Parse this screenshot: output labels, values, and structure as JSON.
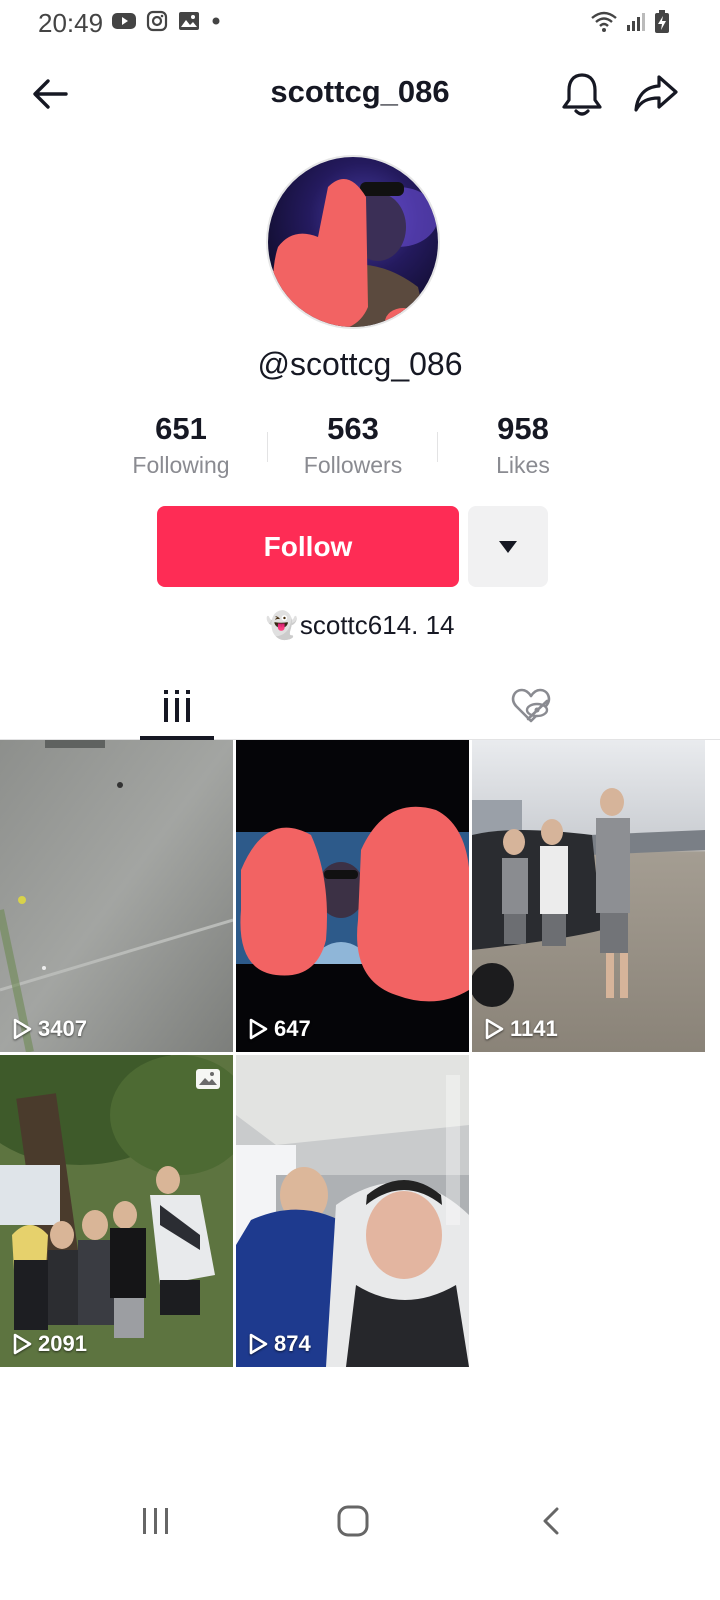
{
  "status_bar": {
    "time": "20:49",
    "left_icons": [
      "youtube-icon",
      "instagram-icon",
      "gallery-icon",
      "dot-icon"
    ],
    "right_icons": [
      "wifi-icon",
      "signal-icon",
      "battery-charging-icon"
    ]
  },
  "header": {
    "title": "scottcg_086",
    "back_icon": "back-arrow-icon",
    "bell_icon": "bell-icon",
    "share_icon": "share-icon"
  },
  "profile": {
    "handle": "@scottcg_086",
    "stats": [
      {
        "value": "651",
        "label": "Following"
      },
      {
        "value": "563",
        "label": "Followers"
      },
      {
        "value": "958",
        "label": "Likes"
      }
    ],
    "follow_label": "Follow",
    "bio_emoji": "👻",
    "bio": "scottc614.  14"
  },
  "tabs": [
    {
      "name": "videos",
      "icon": "grid-icon",
      "active": true
    },
    {
      "name": "liked",
      "icon": "liked-hidden-icon",
      "active": false
    }
  ],
  "videos": [
    {
      "views": "3407"
    },
    {
      "views": "647"
    },
    {
      "views": "1141"
    },
    {
      "views": "2091",
      "is_photo": true
    },
    {
      "views": "874"
    }
  ],
  "colors": {
    "accent": "#fe2c55",
    "text_primary": "#161823",
    "text_secondary": "#8a8b91"
  }
}
